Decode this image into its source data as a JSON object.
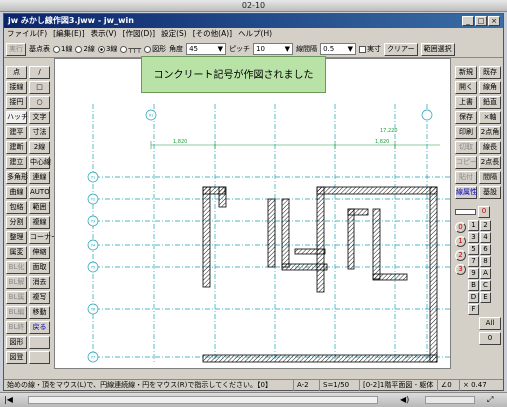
{
  "outer_title": "02-10",
  "window": {
    "title": "jw みかし線作図3.jww - jw_win",
    "controls": [
      "_",
      "□",
      "×"
    ]
  },
  "menu": [
    "ファイル(F)",
    "[編集(E)]",
    "表示(V)",
    "[作図(D)]",
    "設定(S)",
    "[その他(A)]",
    "ヘルプ(H)"
  ],
  "toolbar": {
    "left_btn": "実行",
    "kijun_label": "基点表",
    "radios": [
      "1線",
      "2線",
      "3線"
    ],
    "line_icon": "┬┬┬",
    "shape_label": "図形",
    "angle_label": "角度",
    "angle_value": "45",
    "pitch_label": "ピッチ",
    "pitch_value": "10",
    "width_label": "線間隔",
    "width_value": "0.5",
    "check_label": "実寸",
    "clear_btn": "クリアー",
    "range_btn": "範囲選択"
  },
  "left_tools": [
    [
      "点",
      "/"
    ],
    [
      "接線",
      "□"
    ],
    [
      "接円",
      "○"
    ],
    [
      "ハッチ",
      "文字"
    ],
    [
      "建平",
      "寸法"
    ],
    [
      "建断",
      "2線"
    ],
    [
      "建立",
      "中心線"
    ],
    [
      "多角形",
      "連線"
    ],
    [
      "曲線",
      "AUTO"
    ],
    [
      "包絡",
      "範囲"
    ],
    [
      "分割",
      "複線"
    ],
    [
      "整理",
      "コーナー"
    ],
    [
      "属変",
      "伸縮"
    ],
    [
      "BL化",
      "面取"
    ],
    [
      "BL解",
      "消去"
    ],
    [
      "BL属",
      "複写"
    ],
    [
      "BL編",
      "移動"
    ],
    [
      "BL終",
      "戻る"
    ],
    [
      "図形",
      ""
    ],
    [
      "図登",
      ""
    ]
  ],
  "notice": "コンクリート記号が作図されました",
  "right_tools": [
    [
      "新規",
      "既存"
    ],
    [
      "開く",
      "線角"
    ],
    [
      "上書",
      "鉛直"
    ],
    [
      "保存",
      "×軸"
    ],
    [
      "印刷",
      "2点角"
    ],
    [
      "切取",
      "線長"
    ],
    [
      "コピー",
      "2点長"
    ],
    [
      "貼付",
      "間隔"
    ],
    [
      "線属性",
      "基設"
    ]
  ],
  "layers": {
    "top_num": "0",
    "cols": [
      [
        "1",
        "2"
      ],
      [
        "3",
        "4"
      ],
      [
        "5",
        "6"
      ],
      [
        "7",
        "8"
      ],
      [
        "9",
        "A"
      ],
      [
        "B",
        "C"
      ],
      [
        "D",
        "E"
      ],
      [
        "F",
        ""
      ]
    ],
    "left_nums": [
      "0",
      "1",
      "2",
      "3"
    ],
    "all": "All",
    "zero": "0"
  },
  "status": {
    "message": "始めの線・頂をマウス(L)で、円線連続線・円をマウス(R)で指示してください。【0】",
    "paper": "A-2",
    "scale": "S=1/50",
    "layer": "[0-2]1階平面図 - 躯体",
    "angle": "∠0",
    "zoom": "× 0.47"
  },
  "drawing": {
    "axis_labels": [
      "X1",
      "Y1",
      "Y2",
      "Y3",
      "Y4",
      "Y5",
      "Y6",
      "Y7"
    ],
    "dims": [
      "1,820",
      "1,820",
      "3,640",
      "17,220",
      "1,820"
    ]
  }
}
